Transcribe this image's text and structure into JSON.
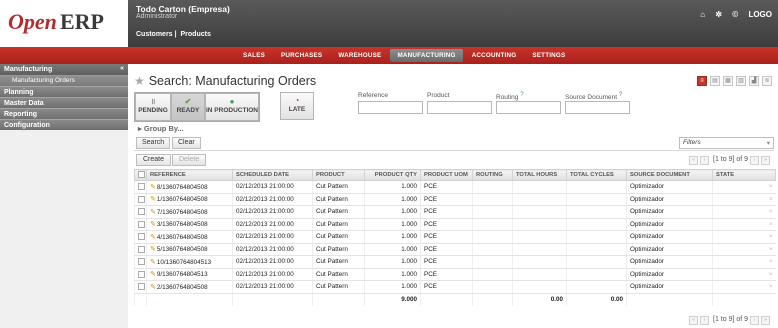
{
  "header": {
    "logo_open": "Open",
    "logo_erp": "ERP",
    "company": "Todo Carton (Empresa)",
    "user": "Administrator",
    "shortcuts": [
      "Customers",
      "Products"
    ],
    "right_label": "LOGO"
  },
  "menubar": {
    "items": [
      "SALES",
      "PURCHASES",
      "WAREHOUSE",
      "MANUFACTURING",
      "ACCOUNTING",
      "SETTINGS"
    ],
    "active": "MANUFACTURING"
  },
  "sidebar": {
    "section": "Manufacturing",
    "collapse": "«",
    "subitem": "Manufacturing Orders",
    "links": [
      "Planning",
      "Master Data",
      "Reporting",
      "Configuration"
    ]
  },
  "search": {
    "title": "Search: Manufacturing Orders",
    "filters": {
      "pending": "PENDING",
      "ready": "READY",
      "in_production": "IN PRODUCTION",
      "late": "LATE"
    },
    "fields": {
      "reference": "Reference",
      "product": "Product",
      "routing": "Routing",
      "source_document": "Source Document",
      "help_mark": "?"
    },
    "group_by": "Group By...",
    "search_label": "Search",
    "clear_label": "Clear",
    "filter_select": "Filters"
  },
  "list": {
    "create_label": "Create",
    "delete_label": "Delete",
    "pager": "[1 to 9] of 9",
    "columns": [
      "REFERENCE",
      "SCHEDULED DATE",
      "PRODUCT",
      "PRODUCT QTY",
      "PRODUCT UOM",
      "ROUTING",
      "TOTAL HOURS",
      "TOTAL CYCLES",
      "SOURCE DOCUMENT",
      "STATE"
    ],
    "rows": [
      {
        "reference": "8/1360764804508",
        "date": "02/12/2013 21:00:00",
        "product": "Cut Pattern",
        "qty": "1.000",
        "uom": "PCE",
        "routing": "",
        "hours": "",
        "cycles": "",
        "source": "Optimizador",
        "state": ""
      },
      {
        "reference": "1/1360764804508",
        "date": "02/12/2013 21:00:00",
        "product": "Cut Pattern",
        "qty": "1.000",
        "uom": "PCE",
        "routing": "",
        "hours": "",
        "cycles": "",
        "source": "Optimizador",
        "state": ""
      },
      {
        "reference": "7/1360764804508",
        "date": "02/12/2013 21:00:00",
        "product": "Cut Pattern",
        "qty": "1.000",
        "uom": "PCE",
        "routing": "",
        "hours": "",
        "cycles": "",
        "source": "Optimizador",
        "state": ""
      },
      {
        "reference": "3/1360764804508",
        "date": "02/12/2013 21:00:00",
        "product": "Cut Pattern",
        "qty": "1.000",
        "uom": "PCE",
        "routing": "",
        "hours": "",
        "cycles": "",
        "source": "Optimizador",
        "state": ""
      },
      {
        "reference": "4/1360764804508",
        "date": "02/12/2013 21:00:00",
        "product": "Cut Pattern",
        "qty": "1.000",
        "uom": "PCE",
        "routing": "",
        "hours": "",
        "cycles": "",
        "source": "Optimizador",
        "state": ""
      },
      {
        "reference": "5/1360764804508",
        "date": "02/12/2013 21:00:00",
        "product": "Cut Pattern",
        "qty": "1.000",
        "uom": "PCE",
        "routing": "",
        "hours": "",
        "cycles": "",
        "source": "Optimizador",
        "state": ""
      },
      {
        "reference": "10/1360764804513",
        "date": "02/12/2013 21:00:00",
        "product": "Cut Pattern",
        "qty": "1.000",
        "uom": "PCE",
        "routing": "",
        "hours": "",
        "cycles": "",
        "source": "Optimizador",
        "state": ""
      },
      {
        "reference": "9/1360764804513",
        "date": "02/12/2013 21:00:00",
        "product": "Cut Pattern",
        "qty": "1.000",
        "uom": "PCE",
        "routing": "",
        "hours": "",
        "cycles": "",
        "source": "Optimizador",
        "state": ""
      },
      {
        "reference": "2/1360764804508",
        "date": "02/12/2013 21:00:00",
        "product": "Cut Pattern",
        "qty": "1.000",
        "uom": "PCE",
        "routing": "",
        "hours": "",
        "cycles": "",
        "source": "Optimizador",
        "state": ""
      }
    ],
    "totals": {
      "qty": "9.000",
      "hours": "0.00",
      "cycles": "0.00"
    }
  },
  "colors": {
    "brand_red": "#b22c2c",
    "menubar": "#c0392b",
    "ready_check": "#5aa33f"
  }
}
